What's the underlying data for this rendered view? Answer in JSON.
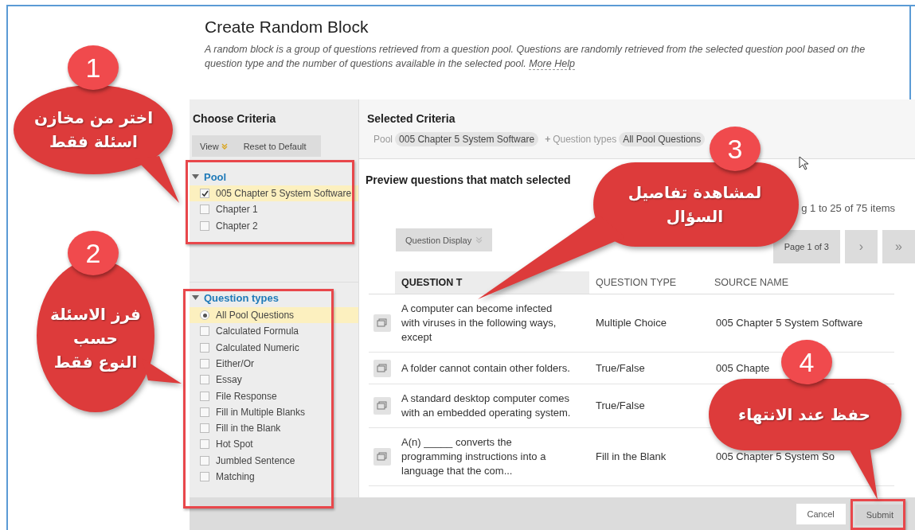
{
  "page": {
    "title": "Create Random Block",
    "description": "A random block is a group of questions retrieved from a question pool. Questions are randomly retrieved from the selected question pool based on the question type and the number of questions available in the selected pool.",
    "help_link": "More Help"
  },
  "criteria_panel": {
    "title": "Choose Criteria",
    "view_button": "View",
    "reset_button": "Reset to Default",
    "sections": [
      {
        "title": "Pool",
        "expanded": true,
        "items": [
          {
            "label": "005 Chapter 5 System Software",
            "kind": "checkbox",
            "checked": true,
            "selected": true
          },
          {
            "label": "Chapter 1",
            "kind": "checkbox",
            "checked": false,
            "selected": false
          },
          {
            "label": "Chapter 2",
            "kind": "checkbox",
            "checked": false,
            "selected": false
          }
        ]
      },
      {
        "title": "Question types",
        "expanded": true,
        "items": [
          {
            "label": "All Pool Questions",
            "kind": "radio",
            "checked": true,
            "selected": true
          },
          {
            "label": "Calculated Formula",
            "kind": "checkbox",
            "checked": false,
            "selected": false
          },
          {
            "label": "Calculated Numeric",
            "kind": "checkbox",
            "checked": false,
            "selected": false
          },
          {
            "label": "Either/Or",
            "kind": "checkbox",
            "checked": false,
            "selected": false
          },
          {
            "label": "Essay",
            "kind": "checkbox",
            "checked": false,
            "selected": false
          },
          {
            "label": "File Response",
            "kind": "checkbox",
            "checked": false,
            "selected": false
          },
          {
            "label": "Fill in Multiple Blanks",
            "kind": "checkbox",
            "checked": false,
            "selected": false
          },
          {
            "label": "Fill in the Blank",
            "kind": "checkbox",
            "checked": false,
            "selected": false
          },
          {
            "label": "Hot Spot",
            "kind": "checkbox",
            "checked": false,
            "selected": false
          },
          {
            "label": "Jumbled Sentence",
            "kind": "checkbox",
            "checked": false,
            "selected": false
          },
          {
            "label": "Matching",
            "kind": "checkbox",
            "checked": false,
            "selected": false
          }
        ]
      }
    ]
  },
  "selected_criteria": {
    "title": "Selected Criteria",
    "filters": [
      {
        "label": "Pool",
        "value": "005 Chapter 5 System Software"
      },
      {
        "prefix": "+",
        "label": "Question types",
        "value": "All Pool Questions"
      }
    ]
  },
  "preview": {
    "title": "Preview questions that match selected",
    "count": "g 1 to 25 of 75 items",
    "display_button": "Question Display",
    "page_label": "Page 1 of 3",
    "next": "›",
    "last": "»",
    "columns": [
      "QUESTION T",
      "QUESTION TYPE",
      "SOURCE NAME"
    ],
    "rows": [
      {
        "text": "A computer can become infected with viruses in the following ways, except",
        "type": "Multiple Choice",
        "source": "005 Chapter 5 System Software"
      },
      {
        "text": "A folder cannot contain other folders.",
        "type": "True/False",
        "source": "005 Chapte"
      },
      {
        "text": "A standard desktop computer comes with an embedded operating system.",
        "type": "True/False"
      },
      {
        "text": "A(n) _____ converts the programming instructions into a language that the com...",
        "type": "Fill in the Blank",
        "source": "005 Chapter 5 System So"
      }
    ]
  },
  "footer": {
    "cancel": "Cancel",
    "submit": "Submit"
  },
  "callouts": [
    {
      "number": "1",
      "text": "اختر من مخازن\nاسئلة فقط"
    },
    {
      "number": "2",
      "text": "فرز الاسئلة\nحسب\nالنوع فقط"
    },
    {
      "number": "3",
      "text": "لمشاهدة تفاصيل\nالسؤال"
    },
    {
      "number": "4",
      "text": "حفظ عند الانتهاء"
    }
  ]
}
